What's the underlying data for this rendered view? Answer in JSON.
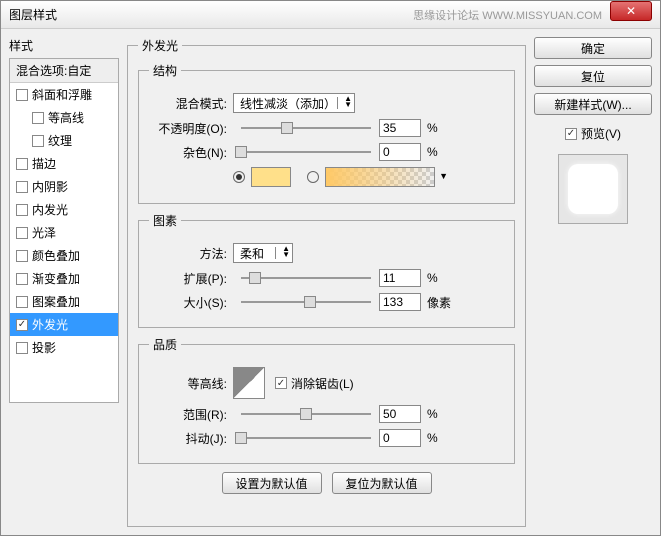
{
  "window": {
    "title": "图层样式",
    "watermark": "思缘设计论坛 WWW.MISSYUAN.COM"
  },
  "left": {
    "styles_label": "样式",
    "blend_options": "混合选项:自定",
    "items": [
      {
        "label": "斜面和浮雕",
        "checked": false,
        "indent": false
      },
      {
        "label": "等高线",
        "checked": false,
        "indent": true
      },
      {
        "label": "纹理",
        "checked": false,
        "indent": true
      },
      {
        "label": "描边",
        "checked": false,
        "indent": false
      },
      {
        "label": "内阴影",
        "checked": false,
        "indent": false
      },
      {
        "label": "内发光",
        "checked": false,
        "indent": false
      },
      {
        "label": "光泽",
        "checked": false,
        "indent": false
      },
      {
        "label": "颜色叠加",
        "checked": false,
        "indent": false
      },
      {
        "label": "渐变叠加",
        "checked": false,
        "indent": false
      },
      {
        "label": "图案叠加",
        "checked": false,
        "indent": false
      },
      {
        "label": "外发光",
        "checked": true,
        "indent": false,
        "selected": true
      },
      {
        "label": "投影",
        "checked": false,
        "indent": false
      }
    ]
  },
  "center": {
    "outer_legend": "外发光",
    "structure": {
      "legend": "结构",
      "blend_mode_label": "混合模式:",
      "blend_mode_value": "线性减淡（添加）",
      "opacity_label": "不透明度(O):",
      "opacity_value": "35",
      "opacity_unit": "%",
      "noise_label": "杂色(N):",
      "noise_value": "0",
      "noise_unit": "%",
      "solid_color": "#ffe08a",
      "gradient_start": "#ffc966"
    },
    "elements": {
      "legend": "图素",
      "technique_label": "方法:",
      "technique_value": "柔和",
      "spread_label": "扩展(P):",
      "spread_value": "11",
      "spread_unit": "%",
      "size_label": "大小(S):",
      "size_value": "133",
      "size_unit": "像素"
    },
    "quality": {
      "legend": "品质",
      "contour_label": "等高线:",
      "antialias_label": "消除锯齿(L)",
      "antialias_checked": true,
      "range_label": "范围(R):",
      "range_value": "50",
      "range_unit": "%",
      "jitter_label": "抖动(J):",
      "jitter_value": "0",
      "jitter_unit": "%"
    },
    "buttons": {
      "default": "设置为默认值",
      "reset": "复位为默认值"
    }
  },
  "right": {
    "ok": "确定",
    "cancel": "复位",
    "new_style": "新建样式(W)...",
    "preview_label": "预览(V)",
    "preview_checked": true
  }
}
